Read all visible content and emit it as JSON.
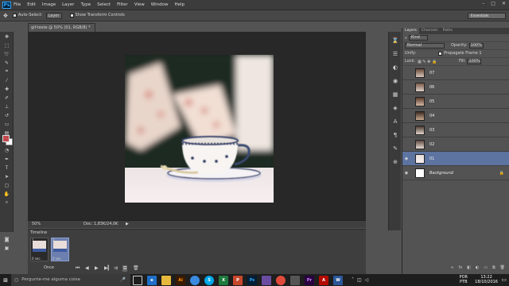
{
  "app": {
    "logo": "Ps"
  },
  "menu": [
    "File",
    "Edit",
    "Image",
    "Layer",
    "Type",
    "Select",
    "Filter",
    "View",
    "Window",
    "Help"
  ],
  "options": {
    "auto_select": "Auto-Select:",
    "auto_select_value": "Layer",
    "transform": "Show Transform Controls",
    "workspace": "Essentials"
  },
  "document": {
    "tab": "gif-teste @ 50% (01, RGB/8) *",
    "zoom": "50%",
    "doc_size": "Doc: 1,83K/24,0K"
  },
  "timeline": {
    "title": "Timeline",
    "frames": [
      {
        "num": "1",
        "delay": "0 sec."
      },
      {
        "num": "2",
        "delay": "0 sec."
      }
    ],
    "loop": "Once"
  },
  "layers": {
    "tabs": [
      "Layers",
      "Channels",
      "Paths"
    ],
    "kind": "Kind",
    "blend": "Normal",
    "opacity_label": "Opacity:",
    "opacity": "100%",
    "unify": "Unify:",
    "propagate": "Propagate Frame 1",
    "lock": "Lock:",
    "fill_label": "Fill:",
    "fill": "100%",
    "items": [
      "07",
      "06",
      "05",
      "04",
      "03",
      "02",
      "01",
      "Background"
    ]
  },
  "taskbar": {
    "search_placeholder": "Pergunte-me alguma coisa",
    "lang_1": "POR",
    "lang_2": "PTB",
    "time": "13:22",
    "date": "18/10/2016"
  },
  "colors": {
    "fg": "#c24a4f",
    "bg": "#ffffff",
    "selection": "#5d73a0",
    "ps_blue": "#31a8ff"
  }
}
